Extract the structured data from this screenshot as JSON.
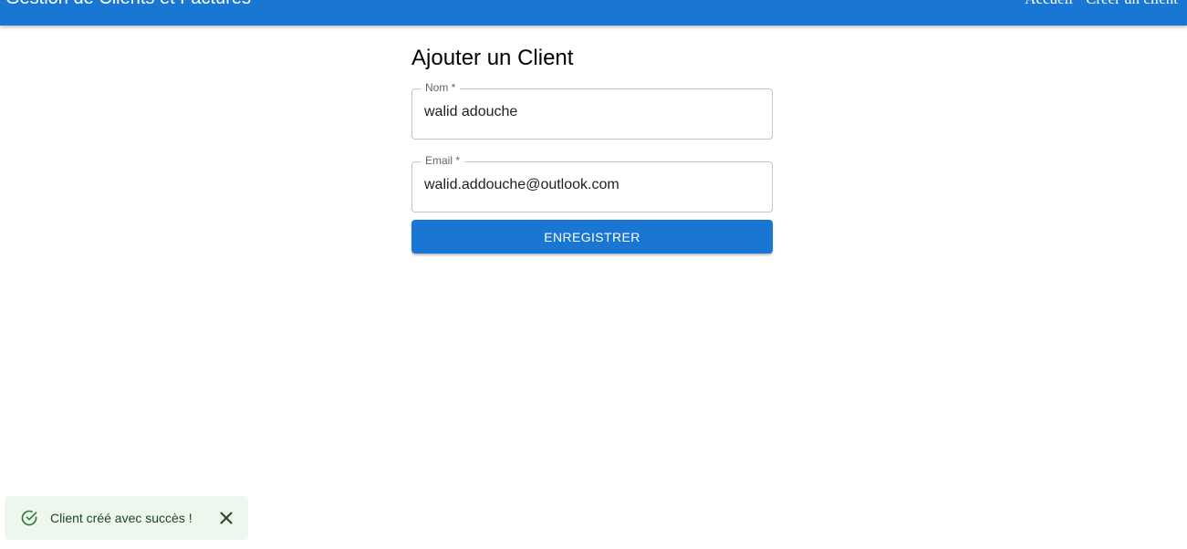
{
  "appbar": {
    "title": "Gestion de Clients et Factures",
    "nav": [
      {
        "label": "Accueil"
      },
      {
        "label": "Créer un client"
      }
    ]
  },
  "form": {
    "title": "Ajouter un Client",
    "fields": {
      "nom": {
        "label": "Nom *",
        "value": "walid adouche"
      },
      "email": {
        "label": "Email *",
        "value": "walid.addouche@outlook.com"
      }
    },
    "submit_label": "ENREGISTRER"
  },
  "snackbar": {
    "message": "Client créé avec succès !",
    "icon": "check-circle-icon",
    "close_icon": "close-icon"
  },
  "colors": {
    "primary": "#1976d2",
    "success_bg": "#edf7ed",
    "success_text": "#1e4620",
    "success_icon": "#2e7d32"
  }
}
